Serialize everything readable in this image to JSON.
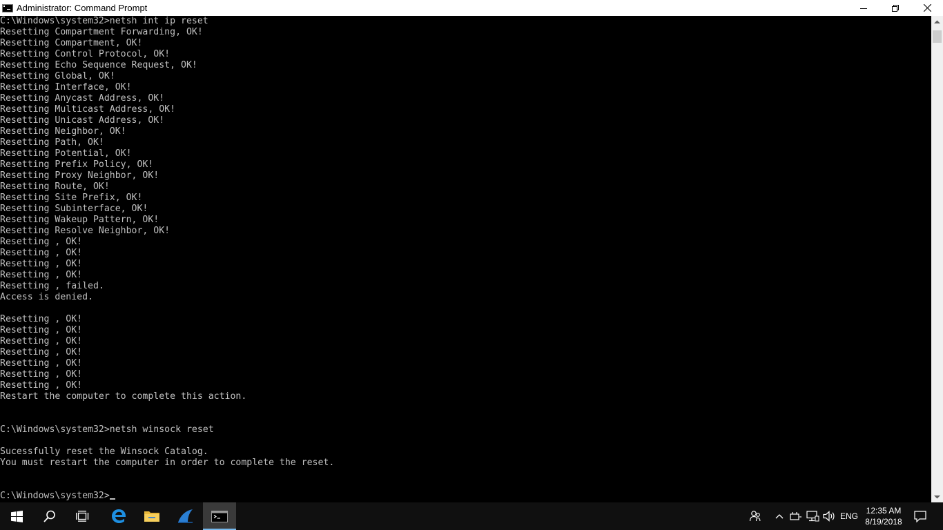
{
  "window": {
    "title": "Administrator: Command Prompt"
  },
  "console": {
    "lines": [
      "C:\\Windows\\system32>netsh int ip reset",
      "Resetting Compartment Forwarding, OK!",
      "Resetting Compartment, OK!",
      "Resetting Control Protocol, OK!",
      "Resetting Echo Sequence Request, OK!",
      "Resetting Global, OK!",
      "Resetting Interface, OK!",
      "Resetting Anycast Address, OK!",
      "Resetting Multicast Address, OK!",
      "Resetting Unicast Address, OK!",
      "Resetting Neighbor, OK!",
      "Resetting Path, OK!",
      "Resetting Potential, OK!",
      "Resetting Prefix Policy, OK!",
      "Resetting Proxy Neighbor, OK!",
      "Resetting Route, OK!",
      "Resetting Site Prefix, OK!",
      "Resetting Subinterface, OK!",
      "Resetting Wakeup Pattern, OK!",
      "Resetting Resolve Neighbor, OK!",
      "Resetting , OK!",
      "Resetting , OK!",
      "Resetting , OK!",
      "Resetting , OK!",
      "Resetting , failed.",
      "Access is denied.",
      "",
      "Resetting , OK!",
      "Resetting , OK!",
      "Resetting , OK!",
      "Resetting , OK!",
      "Resetting , OK!",
      "Resetting , OK!",
      "Resetting , OK!",
      "Restart the computer to complete this action.",
      "",
      "",
      "C:\\Windows\\system32>netsh winsock reset",
      "",
      "Sucessfully reset the Winsock Catalog.",
      "You must restart the computer in order to complete the reset.",
      "",
      "",
      "C:\\Windows\\system32>"
    ]
  },
  "taskbar": {
    "apps": [
      {
        "name": "start-icon"
      },
      {
        "name": "search-icon"
      },
      {
        "name": "task-view-icon"
      },
      {
        "name": "edge-icon"
      },
      {
        "name": "file-explorer-icon"
      },
      {
        "name": "wireshark-icon"
      },
      {
        "name": "command-prompt-icon",
        "active": true
      }
    ],
    "tray": {
      "language": "ENG",
      "time": "12:35 AM",
      "date": "8/19/2018"
    }
  },
  "colors": {
    "console_bg": "#000000",
    "console_fg": "#c0c0c0",
    "taskbar_bg": "#101010",
    "accent": "#76b9ed"
  }
}
